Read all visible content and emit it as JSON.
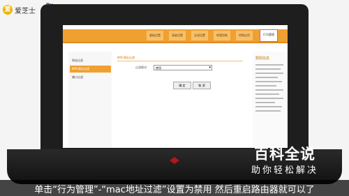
{
  "brand": {
    "name": "爱芝士",
    "mark": "爱",
    "partner": "Pu",
    "partner_sub": ""
  },
  "router": {
    "nav_tabs": [
      {
        "label": "基础设置"
      },
      {
        "label": "高级设置"
      },
      {
        "label": "无线设置"
      },
      {
        "label": "带宽控制"
      },
      {
        "label": "特殊应用"
      },
      {
        "label": "行为管理"
      }
    ],
    "active_tab": "行为管理",
    "sidebar": [
      {
        "label": "网站过滤"
      },
      {
        "label": "MAC地址过滤"
      },
      {
        "label": "端口过滤"
      }
    ],
    "section_title": "MAC地址过滤",
    "filter_label": "过滤模式:",
    "filter_value": "禁用",
    "ok_button": "确 定",
    "cancel_button": "取 消",
    "help_title": "帮助信息"
  },
  "watermark": {
    "main": "百科全说",
    "sub": "助你轻松解决"
  },
  "subtitle": "单击“行为管理”-“mac地址过滤”设置为禁用 然后重启路由器就可以了",
  "colors": {
    "accent": "#f0a030",
    "highlight": "#e65a5a"
  }
}
